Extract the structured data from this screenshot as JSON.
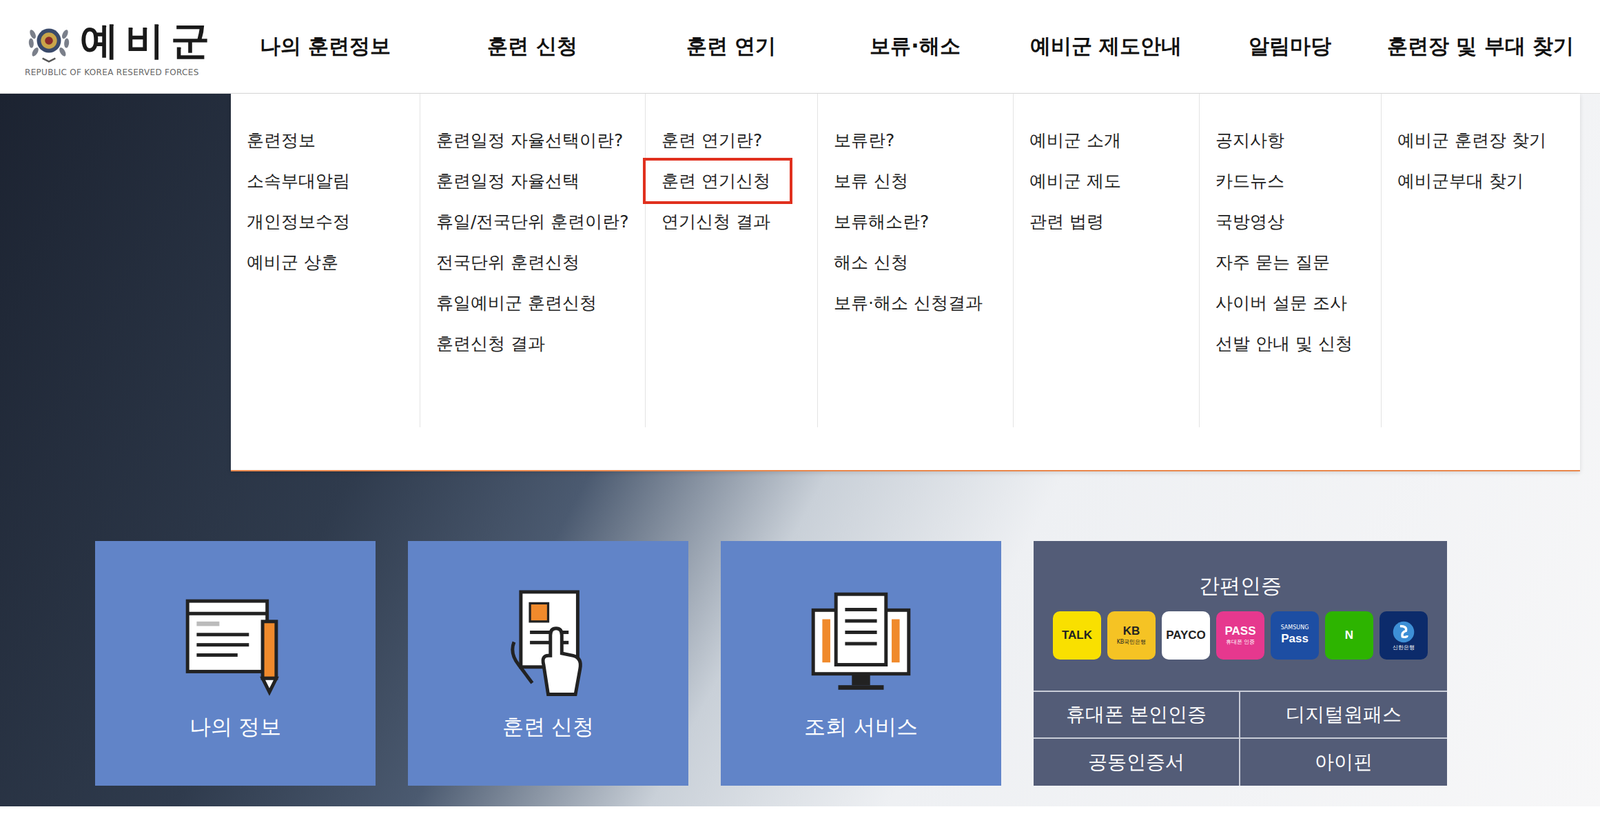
{
  "logo": {
    "title": "예비군",
    "subtitle": "REPUBLIC OF KOREA RESERVED FORCES"
  },
  "nav": [
    {
      "label": "나의 훈련정보",
      "items": [
        {
          "label": "훈련정보",
          "highlighted": false
        },
        {
          "label": "소속부대알림",
          "highlighted": false
        },
        {
          "label": "개인정보수정",
          "highlighted": false
        },
        {
          "label": "예비군 상훈",
          "highlighted": false
        }
      ]
    },
    {
      "label": "훈련 신청",
      "items": [
        {
          "label": "훈련일정 자율선택이란?",
          "highlighted": false
        },
        {
          "label": "훈련일정 자율선택",
          "highlighted": false
        },
        {
          "label": "휴일/전국단위 훈련이란?",
          "highlighted": false
        },
        {
          "label": "전국단위 훈련신청",
          "highlighted": false
        },
        {
          "label": "휴일예비군 훈련신청",
          "highlighted": false
        },
        {
          "label": "훈련신청 결과",
          "highlighted": false
        }
      ]
    },
    {
      "label": "훈련 연기",
      "items": [
        {
          "label": "훈련 연기란?",
          "highlighted": false
        },
        {
          "label": "훈련 연기신청",
          "highlighted": true
        },
        {
          "label": "연기신청 결과",
          "highlighted": false
        }
      ]
    },
    {
      "label": "보류·해소",
      "items": [
        {
          "label": "보류란?",
          "highlighted": false
        },
        {
          "label": "보류 신청",
          "highlighted": false
        },
        {
          "label": "보류해소란?",
          "highlighted": false
        },
        {
          "label": "해소 신청",
          "highlighted": false
        },
        {
          "label": "보류·해소 신청결과",
          "highlighted": false
        }
      ]
    },
    {
      "label": "예비군 제도안내",
      "items": [
        {
          "label": "예비군 소개",
          "highlighted": false
        },
        {
          "label": "예비군 제도",
          "highlighted": false
        },
        {
          "label": "관련 법령",
          "highlighted": false
        }
      ]
    },
    {
      "label": "알림마당",
      "items": [
        {
          "label": "공지사항",
          "highlighted": false
        },
        {
          "label": "카드뉴스",
          "highlighted": false
        },
        {
          "label": "국방영상",
          "highlighted": false
        },
        {
          "label": "자주 묻는 질문",
          "highlighted": false
        },
        {
          "label": "사이버 설문 조사",
          "highlighted": false
        },
        {
          "label": "선발 안내 및 신청",
          "highlighted": false
        }
      ]
    },
    {
      "label": "훈련장 및 부대 찾기",
      "items": [
        {
          "label": "예비군 훈련장 찾기",
          "highlighted": false
        },
        {
          "label": "예비군부대 찾기",
          "highlighted": false
        }
      ]
    }
  ],
  "quick_links": [
    {
      "label": "나의 정보",
      "kind": "profile"
    },
    {
      "label": "훈련 신청",
      "kind": "apply"
    },
    {
      "label": "조회 서비스",
      "kind": "lookup"
    }
  ],
  "auth": {
    "title": "간편인증",
    "apps": [
      {
        "kind": "text",
        "label": "TALK",
        "caption": "",
        "color": "#f9e000"
      },
      {
        "kind": "text",
        "label": "KB",
        "caption": "KB국민은행",
        "color": "#f5c324"
      },
      {
        "kind": "text",
        "label": "PAYCO",
        "caption": "",
        "color": "#ffffff"
      },
      {
        "kind": "text",
        "label": "PASS",
        "caption": "휴대폰 인증",
        "color": "#e6388e"
      },
      {
        "kind": "top",
        "label": "Pass",
        "caption": "SAMSUNG",
        "color": "#1d4ea3"
      },
      {
        "kind": "text",
        "label": "N",
        "caption": "",
        "color": "#2db400"
      },
      {
        "kind": "emblem",
        "label": "신한은행",
        "caption": "",
        "color": "#0c2b6b"
      }
    ],
    "methods": [
      "휴대폰 본인인증",
      "디지털원패스",
      "공동인증서",
      "아이핀"
    ]
  }
}
